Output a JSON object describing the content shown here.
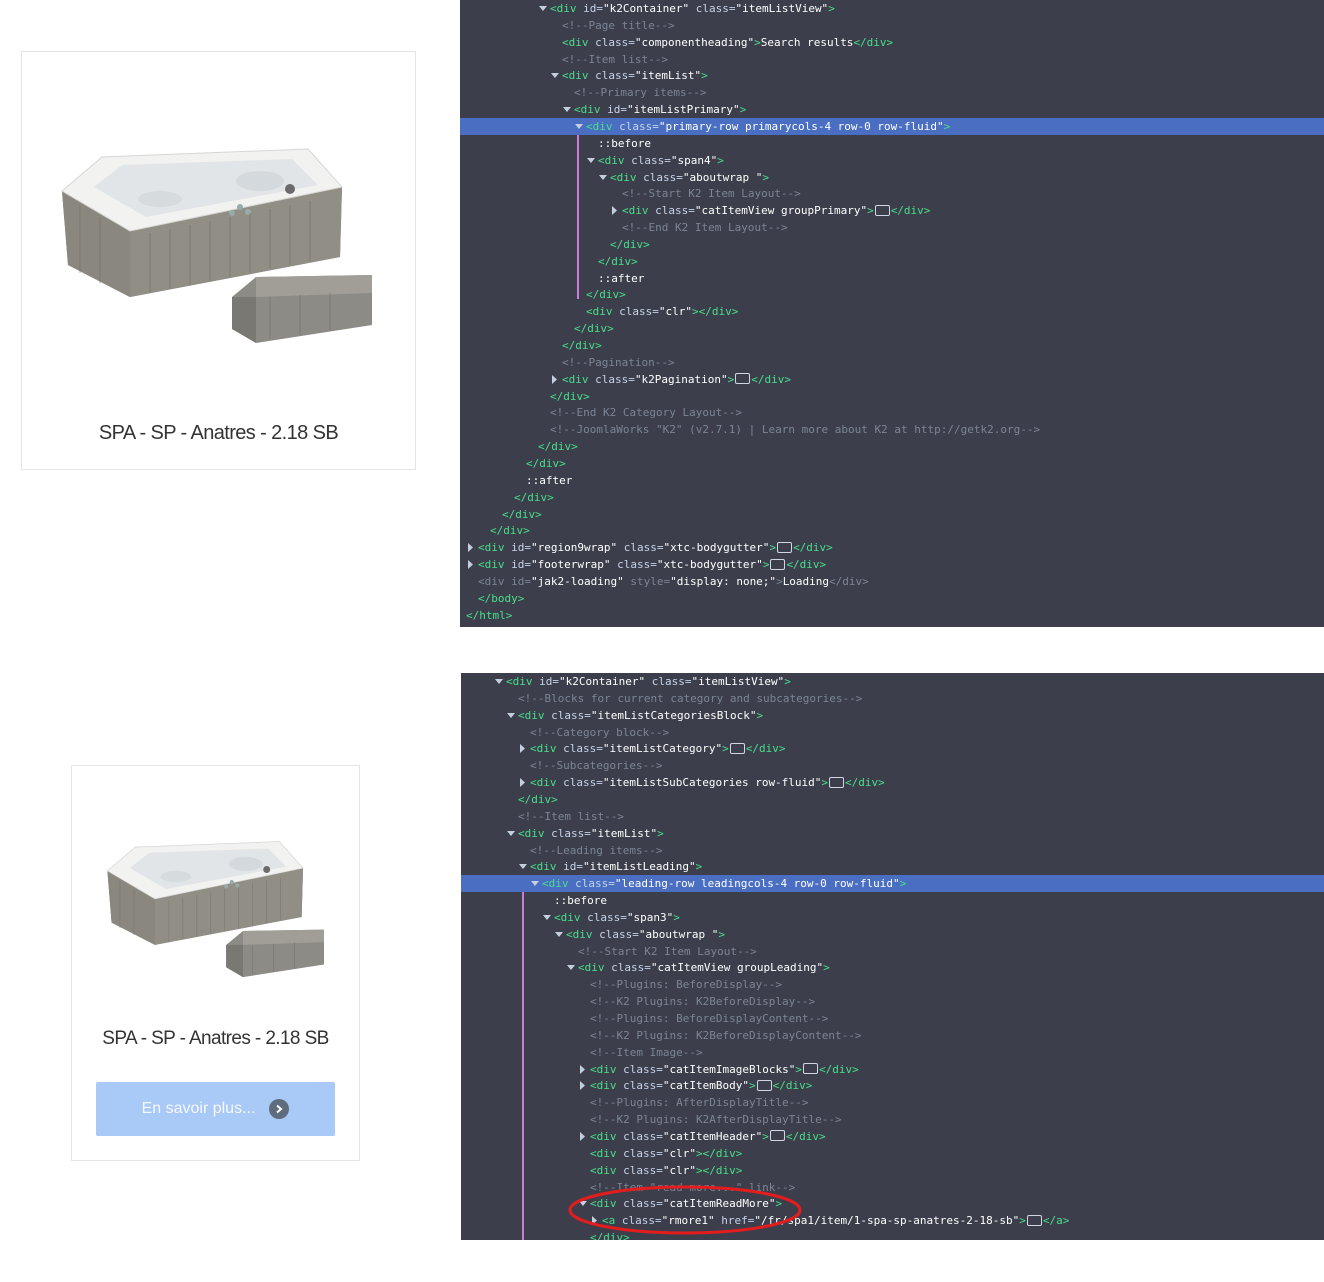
{
  "top_card": {
    "title": "SPA - SP - Anatres - 2.18 SB"
  },
  "bottom_card": {
    "title": "SPA - SP - Anatres - 2.18 SB",
    "read_more_label": "En savoir plus..."
  },
  "colors": {
    "devtools_bg": "#3c3f4b",
    "selected_line": "#4a6fc2",
    "tag": "#48de8a",
    "comment": "#7b8496",
    "button_bg": "#a9c9f6",
    "annotation": "#e31d1d"
  },
  "devtools_top": {
    "lines": [
      {
        "d": 7,
        "x": "o",
        "segs": [
          [
            "t",
            "<div "
          ],
          [
            "a",
            "id="
          ],
          [
            "v",
            "\"k2Container\" "
          ],
          [
            "a",
            "class="
          ],
          [
            "v",
            "\"itemListView\""
          ],
          [
            "t",
            ">"
          ]
        ]
      },
      {
        "d": 8,
        "segs": [
          [
            "c",
            "<!--Page title-->"
          ]
        ]
      },
      {
        "d": 8,
        "segs": [
          [
            "t",
            "<div "
          ],
          [
            "a",
            "class="
          ],
          [
            "v",
            "\"componentheading\""
          ],
          [
            "t",
            ">"
          ],
          [
            "p",
            "Search results"
          ],
          [
            "t",
            "</div>"
          ]
        ]
      },
      {
        "d": 8,
        "segs": [
          [
            "c",
            "<!--Item list-->"
          ]
        ]
      },
      {
        "d": 8,
        "x": "o",
        "segs": [
          [
            "t",
            "<div "
          ],
          [
            "a",
            "class="
          ],
          [
            "v",
            "\"itemList\""
          ],
          [
            "t",
            ">"
          ]
        ]
      },
      {
        "d": 9,
        "segs": [
          [
            "c",
            "<!--Primary items-->"
          ]
        ]
      },
      {
        "d": 9,
        "x": "o",
        "segs": [
          [
            "t",
            "<div "
          ],
          [
            "a",
            "id="
          ],
          [
            "v",
            "\"itemListPrimary\""
          ],
          [
            "t",
            ">"
          ]
        ]
      },
      {
        "d": 10,
        "x": "o",
        "sel": true,
        "segs": [
          [
            "t",
            "<div "
          ],
          [
            "a",
            "class="
          ],
          [
            "v",
            "\"primary-row primarycols-4 row-0 row-fluid\""
          ],
          [
            "t",
            ">"
          ]
        ]
      },
      {
        "d": 11,
        "segs": [
          [
            "p",
            "::before"
          ]
        ]
      },
      {
        "d": 11,
        "x": "o",
        "segs": [
          [
            "t",
            "<div "
          ],
          [
            "a",
            "class="
          ],
          [
            "v",
            "\"span4\""
          ],
          [
            "t",
            ">"
          ]
        ]
      },
      {
        "d": 12,
        "x": "o",
        "segs": [
          [
            "t",
            "<div "
          ],
          [
            "a",
            "class="
          ],
          [
            "v",
            "\"aboutwrap \""
          ],
          [
            "t",
            ">"
          ]
        ]
      },
      {
        "d": 13,
        "segs": [
          [
            "c",
            "<!--Start K2 Item Layout-->"
          ]
        ]
      },
      {
        "d": 13,
        "x": "c",
        "segs": [
          [
            "t",
            "<div "
          ],
          [
            "a",
            "class="
          ],
          [
            "v",
            "\"catItemView groupPrimary\""
          ],
          [
            "t",
            ">"
          ],
          [
            "e",
            ""
          ],
          [
            "t",
            "</div>"
          ]
        ]
      },
      {
        "d": 13,
        "segs": [
          [
            "c",
            "<!--End K2 Item Layout-->"
          ]
        ]
      },
      {
        "d": 12,
        "segs": [
          [
            "t",
            "</div>"
          ]
        ]
      },
      {
        "d": 11,
        "segs": [
          [
            "t",
            "</div>"
          ]
        ]
      },
      {
        "d": 11,
        "segs": [
          [
            "p",
            "::after"
          ]
        ]
      },
      {
        "d": 10,
        "segs": [
          [
            "t",
            "</div>"
          ]
        ]
      },
      {
        "d": 10,
        "segs": [
          [
            "t",
            "<div "
          ],
          [
            "a",
            "class="
          ],
          [
            "v",
            "\"clr\""
          ],
          [
            "t",
            "></div>"
          ]
        ]
      },
      {
        "d": 9,
        "segs": [
          [
            "t",
            "</div>"
          ]
        ]
      },
      {
        "d": 8,
        "segs": [
          [
            "t",
            "</div>"
          ]
        ]
      },
      {
        "d": 8,
        "segs": [
          [
            "c",
            "<!--Pagination-->"
          ]
        ]
      },
      {
        "d": 8,
        "x": "c",
        "segs": [
          [
            "t",
            "<div "
          ],
          [
            "a",
            "class="
          ],
          [
            "v",
            "\"k2Pagination\""
          ],
          [
            "t",
            ">"
          ],
          [
            "e",
            ""
          ],
          [
            "t",
            "</div>"
          ]
        ]
      },
      {
        "d": 7,
        "segs": [
          [
            "t",
            "</div>"
          ]
        ]
      },
      {
        "d": 7,
        "segs": [
          [
            "c",
            "<!--End K2 Category Layout-->"
          ]
        ]
      },
      {
        "d": 7,
        "segs": [
          [
            "c",
            "<!--JoomlaWorks \"K2\" (v2.7.1) | Learn more about K2 at http://getk2.org-->"
          ]
        ]
      },
      {
        "d": 6,
        "segs": [
          [
            "t",
            "</div>"
          ]
        ]
      },
      {
        "d": 5,
        "segs": [
          [
            "t",
            "</div>"
          ]
        ]
      },
      {
        "d": 5,
        "segs": [
          [
            "p",
            "::after"
          ]
        ]
      },
      {
        "d": 4,
        "segs": [
          [
            "t",
            "</div>"
          ]
        ]
      },
      {
        "d": 3,
        "segs": [
          [
            "t",
            "</div>"
          ]
        ]
      },
      {
        "d": 2,
        "segs": [
          [
            "t",
            "</div>"
          ]
        ]
      },
      {
        "d": 1,
        "x": "c",
        "segs": [
          [
            "t",
            "<div "
          ],
          [
            "a",
            "id="
          ],
          [
            "v",
            "\"region9wrap\" "
          ],
          [
            "a",
            "class="
          ],
          [
            "v",
            "\"xtc-bodygutter\""
          ],
          [
            "t",
            ">"
          ],
          [
            "e",
            ""
          ],
          [
            "t",
            "</div>"
          ]
        ]
      },
      {
        "d": 1,
        "x": "c",
        "segs": [
          [
            "t",
            "<div "
          ],
          [
            "a",
            "id="
          ],
          [
            "v",
            "\"footerwrap\" "
          ],
          [
            "a",
            "class="
          ],
          [
            "v",
            "\"xtc-bodygutter\""
          ],
          [
            "t",
            ">"
          ],
          [
            "e",
            ""
          ],
          [
            "t",
            "</div>"
          ]
        ]
      },
      {
        "d": 1,
        "segs": [
          [
            "c",
            "<div "
          ],
          [
            "c",
            "id="
          ],
          [
            "v",
            "\"jak2-loading\" "
          ],
          [
            "c",
            "style="
          ],
          [
            "v",
            "\"display: none;\""
          ],
          [
            "c",
            ">"
          ],
          [
            "p",
            "Loading"
          ],
          [
            "c",
            "</div>"
          ]
        ]
      },
      {
        "d": 1,
        "segs": [
          [
            "t",
            "</body>"
          ]
        ]
      },
      {
        "d": 0,
        "segs": [
          [
            "t",
            "</html>"
          ]
        ]
      }
    ]
  },
  "devtools_bottom": {
    "lines": [
      {
        "d": 2,
        "x": "o",
        "segs": [
          [
            "t",
            "<div "
          ],
          [
            "a",
            "id="
          ],
          [
            "v",
            "\"k2Container\" "
          ],
          [
            "a",
            "class="
          ],
          [
            "v",
            "\"itemListView\""
          ],
          [
            "t",
            ">"
          ]
        ]
      },
      {
        "d": 3,
        "segs": [
          [
            "c",
            "<!--Blocks for current category and subcategories-->"
          ]
        ]
      },
      {
        "d": 3,
        "x": "o",
        "segs": [
          [
            "t",
            "<div "
          ],
          [
            "a",
            "class="
          ],
          [
            "v",
            "\"itemListCategoriesBlock\""
          ],
          [
            "t",
            ">"
          ]
        ]
      },
      {
        "d": 4,
        "segs": [
          [
            "c",
            "<!--Category block-->"
          ]
        ]
      },
      {
        "d": 4,
        "x": "c",
        "segs": [
          [
            "t",
            "<div "
          ],
          [
            "a",
            "class="
          ],
          [
            "v",
            "\"itemListCategory\""
          ],
          [
            "t",
            ">"
          ],
          [
            "e",
            ""
          ],
          [
            "t",
            "</div>"
          ]
        ]
      },
      {
        "d": 4,
        "segs": [
          [
            "c",
            "<!--Subcategories-->"
          ]
        ]
      },
      {
        "d": 4,
        "x": "c",
        "segs": [
          [
            "t",
            "<div "
          ],
          [
            "a",
            "class="
          ],
          [
            "v",
            "\"itemListSubCategories row-fluid\""
          ],
          [
            "t",
            ">"
          ],
          [
            "e",
            ""
          ],
          [
            "t",
            "</div>"
          ]
        ]
      },
      {
        "d": 3,
        "segs": [
          [
            "t",
            "</div>"
          ]
        ]
      },
      {
        "d": 3,
        "segs": [
          [
            "c",
            "<!--Item list-->"
          ]
        ]
      },
      {
        "d": 3,
        "x": "o",
        "segs": [
          [
            "t",
            "<div "
          ],
          [
            "a",
            "class="
          ],
          [
            "v",
            "\"itemList\""
          ],
          [
            "t",
            ">"
          ]
        ]
      },
      {
        "d": 4,
        "segs": [
          [
            "c",
            "<!--Leading items-->"
          ]
        ]
      },
      {
        "d": 4,
        "x": "o",
        "segs": [
          [
            "t",
            "<div "
          ],
          [
            "a",
            "id="
          ],
          [
            "v",
            "\"itemListLeading\""
          ],
          [
            "t",
            ">"
          ]
        ]
      },
      {
        "d": 5,
        "x": "o",
        "sel": true,
        "segs": [
          [
            "t",
            "<div "
          ],
          [
            "a",
            "class="
          ],
          [
            "v",
            "\"leading-row leadingcols-4 row-0 row-fluid\""
          ],
          [
            "t",
            ">"
          ]
        ]
      },
      {
        "d": 6,
        "segs": [
          [
            "p",
            "::before"
          ]
        ]
      },
      {
        "d": 6,
        "x": "o",
        "segs": [
          [
            "t",
            "<div "
          ],
          [
            "a",
            "class="
          ],
          [
            "v",
            "\"span3\""
          ],
          [
            "t",
            ">"
          ]
        ]
      },
      {
        "d": 7,
        "x": "o",
        "segs": [
          [
            "t",
            "<div "
          ],
          [
            "a",
            "class="
          ],
          [
            "v",
            "\"aboutwrap \""
          ],
          [
            "t",
            ">"
          ]
        ]
      },
      {
        "d": 8,
        "segs": [
          [
            "c",
            "<!--Start K2 Item Layout-->"
          ]
        ]
      },
      {
        "d": 8,
        "x": "o",
        "segs": [
          [
            "t",
            "<div "
          ],
          [
            "a",
            "class="
          ],
          [
            "v",
            "\"catItemView groupLeading\""
          ],
          [
            "t",
            ">"
          ]
        ]
      },
      {
        "d": 9,
        "segs": [
          [
            "c",
            "<!--Plugins: BeforeDisplay-->"
          ]
        ]
      },
      {
        "d": 9,
        "segs": [
          [
            "c",
            "<!--K2 Plugins: K2BeforeDisplay-->"
          ]
        ]
      },
      {
        "d": 9,
        "segs": [
          [
            "c",
            "<!--Plugins: BeforeDisplayContent-->"
          ]
        ]
      },
      {
        "d": 9,
        "segs": [
          [
            "c",
            "<!--K2 Plugins: K2BeforeDisplayContent-->"
          ]
        ]
      },
      {
        "d": 9,
        "segs": [
          [
            "c",
            "<!--Item Image-->"
          ]
        ]
      },
      {
        "d": 9,
        "x": "c",
        "segs": [
          [
            "t",
            "<div "
          ],
          [
            "a",
            "class="
          ],
          [
            "v",
            "\"catItemImageBlocks\""
          ],
          [
            "t",
            ">"
          ],
          [
            "e",
            ""
          ],
          [
            "t",
            "</div>"
          ]
        ]
      },
      {
        "d": 9,
        "x": "c",
        "segs": [
          [
            "t",
            "<div "
          ],
          [
            "a",
            "class="
          ],
          [
            "v",
            "\"catItemBody\""
          ],
          [
            "t",
            ">"
          ],
          [
            "e",
            ""
          ],
          [
            "t",
            "</div>"
          ]
        ]
      },
      {
        "d": 9,
        "segs": [
          [
            "c",
            "<!--Plugins: AfterDisplayTitle-->"
          ]
        ]
      },
      {
        "d": 9,
        "segs": [
          [
            "c",
            "<!--K2 Plugins: K2AfterDisplayTitle-->"
          ]
        ]
      },
      {
        "d": 9,
        "x": "c",
        "segs": [
          [
            "t",
            "<div "
          ],
          [
            "a",
            "class="
          ],
          [
            "v",
            "\"catItemHeader\""
          ],
          [
            "t",
            ">"
          ],
          [
            "e",
            ""
          ],
          [
            "t",
            "</div>"
          ]
        ]
      },
      {
        "d": 9,
        "segs": [
          [
            "t",
            "<div "
          ],
          [
            "a",
            "class="
          ],
          [
            "v",
            "\"clr\""
          ],
          [
            "t",
            "></div>"
          ]
        ]
      },
      {
        "d": 9,
        "segs": [
          [
            "t",
            "<div "
          ],
          [
            "a",
            "class="
          ],
          [
            "v",
            "\"clr\""
          ],
          [
            "t",
            "></div>"
          ]
        ]
      },
      {
        "d": 9,
        "segs": [
          [
            "c",
            "<!--Item \"read more...\" link-->"
          ]
        ]
      },
      {
        "d": 9,
        "x": "o",
        "segs": [
          [
            "t",
            "<div "
          ],
          [
            "a",
            "class="
          ],
          [
            "v",
            "\"catItemReadMore\""
          ],
          [
            "t",
            ">"
          ]
        ]
      },
      {
        "d": 10,
        "x": "c",
        "segs": [
          [
            "t",
            "<a "
          ],
          [
            "a",
            "class="
          ],
          [
            "v",
            "\"rmore1\" "
          ],
          [
            "a",
            "href="
          ],
          [
            "v",
            "\"/fr/spa1/item/1-spa-sp-anatres-2-18-sb\""
          ],
          [
            "t",
            ">"
          ],
          [
            "e",
            ""
          ],
          [
            "t",
            "</a>"
          ]
        ]
      },
      {
        "d": 9,
        "segs": [
          [
            "t",
            "</div>"
          ]
        ]
      }
    ]
  }
}
